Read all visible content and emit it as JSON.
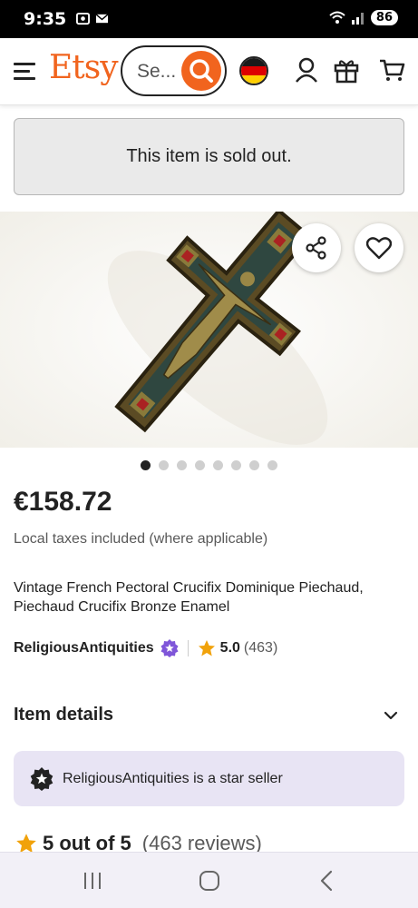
{
  "status_bar": {
    "time": "9:35",
    "battery": "86"
  },
  "header": {
    "logo": "Etsy",
    "search_placeholder": "Se...",
    "flag": "germany-flag"
  },
  "sold_out_message": "This item is sold out.",
  "carousel": {
    "total": 8,
    "active_index": 0
  },
  "product": {
    "price": "€158.72",
    "tax_note": "Local taxes included (where applicable)",
    "title": "Vintage French Pectoral Crucifix Dominique Piechaud, Piechaud Crucifix Bronze Enamel",
    "seller": "ReligiousAntiquities",
    "rating": "5.0",
    "rating_count": "(463)"
  },
  "item_details_label": "Item details",
  "star_seller_text": "ReligiousAntiquities is a star seller",
  "reviews": {
    "score": "5 out of 5",
    "count": "(463 reviews)"
  },
  "colors": {
    "brand": "#f1641e",
    "star_seller_bg": "#e8e4f4",
    "star": "#f1a20a"
  }
}
